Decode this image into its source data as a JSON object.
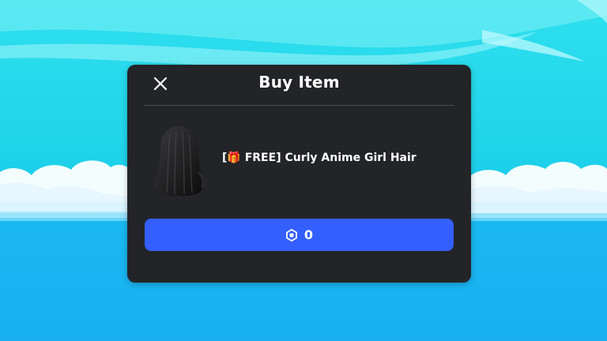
{
  "dialog": {
    "title": "Buy Item",
    "close_icon": "close-icon"
  },
  "item": {
    "name_prefix": "[",
    "gift_icon": "🎁",
    "name_rest": " FREE] Curly Anime Girl Hair",
    "thumbnail_icon": "hair-thumbnail"
  },
  "purchase": {
    "currency_icon": "robux-icon",
    "price": "0"
  },
  "colors": {
    "modal_bg": "#232428",
    "button_bg": "#335fff",
    "sky": "#2fe0ee",
    "sea": "#18b0f0"
  }
}
